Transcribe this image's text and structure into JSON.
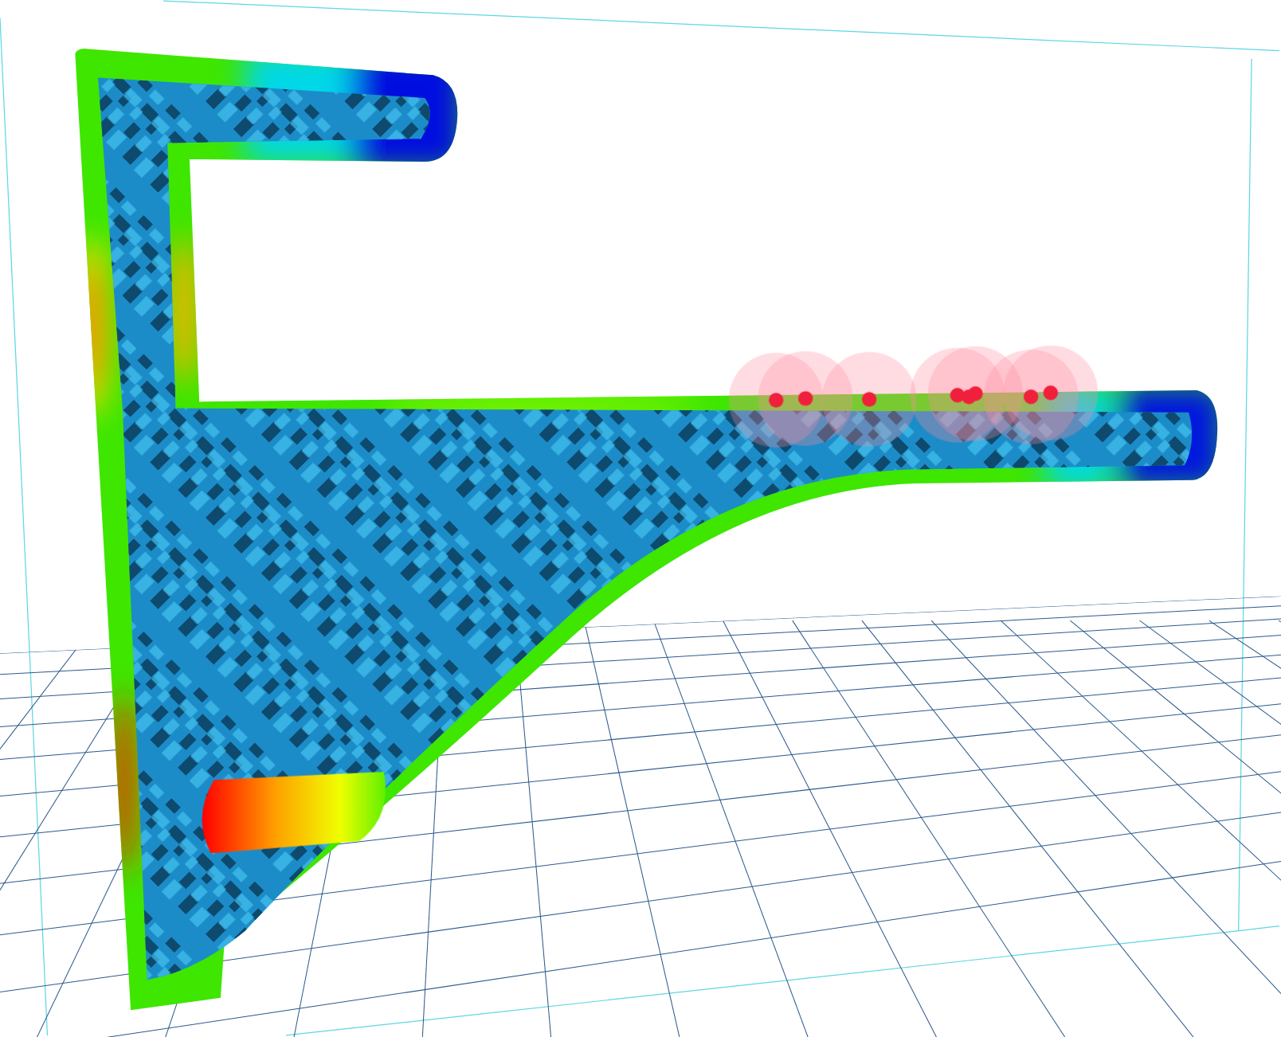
{
  "viewport": {
    "show_floor_grid": true,
    "show_bounding_box": true,
    "show_load_markers": true
  }
}
